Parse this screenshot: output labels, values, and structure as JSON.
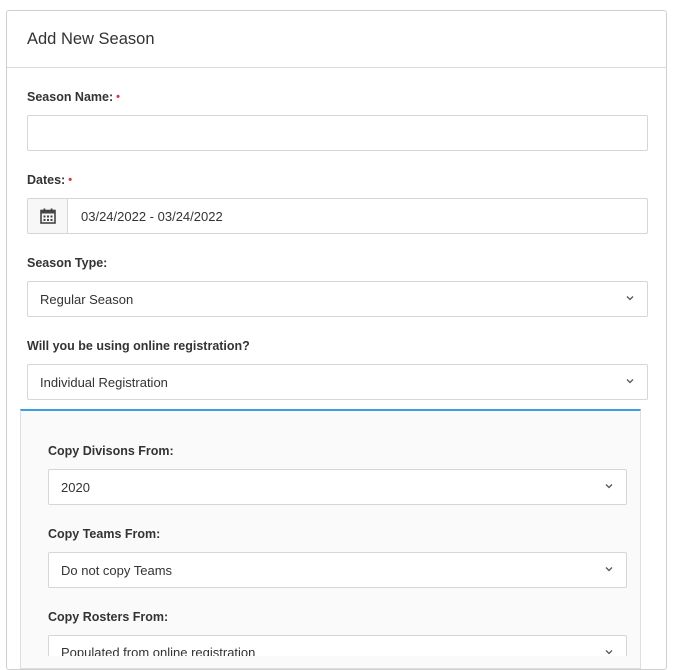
{
  "form": {
    "title": "Add New Season",
    "season_name": {
      "label": "Season Name:",
      "required_mark": "•",
      "value": "",
      "placeholder": ""
    },
    "dates": {
      "label": "Dates:",
      "required_mark": "•",
      "value": "03/24/2022 - 03/24/2022",
      "icon": "calendar-icon"
    },
    "season_type": {
      "label": "Season Type:",
      "value": "Regular Season",
      "icon": "chevron-down-icon"
    },
    "online_registration": {
      "label": "Will you be using online registration?",
      "value": "Individual Registration",
      "icon": "chevron-down-icon"
    }
  },
  "copy_panel": {
    "accent_color": "#3c9ee0",
    "divisions": {
      "label": "Copy Divisons From:",
      "value": "2020"
    },
    "teams": {
      "label": "Copy Teams From:",
      "value": "Do not copy Teams"
    },
    "rosters": {
      "label": "Copy Rosters From:",
      "value": "Populated from online registration"
    }
  },
  "colors": {
    "required": "#d9363e",
    "border": "#d6d6d6",
    "text": "#333333"
  }
}
